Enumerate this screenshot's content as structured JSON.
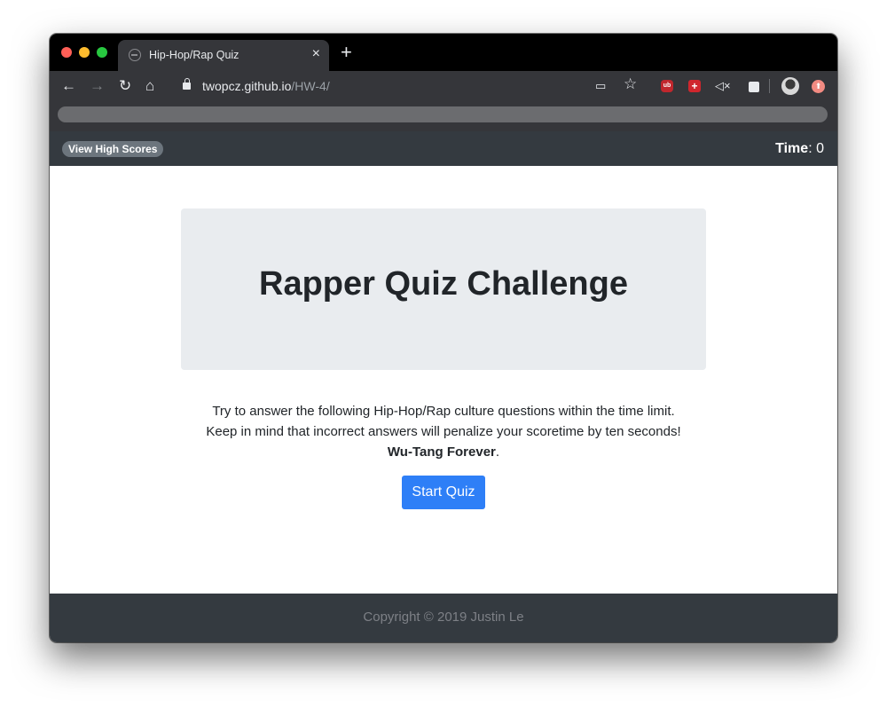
{
  "browser": {
    "tab_title": "Hip-Hop/Rap Quiz",
    "tab_close": "×",
    "new_tab": "+",
    "url_host": "twopcz.github.io",
    "url_path": "/HW-4/",
    "nav": {
      "back": "←",
      "forward": "→",
      "reload": "↻",
      "home": "⌂"
    },
    "toolbar_icons": {
      "cast": "▭",
      "star": "☆",
      "mute": "◁×"
    },
    "extension_ublock": "ub",
    "extension_plus": "+"
  },
  "header": {
    "high_scores_label": "View High Scores",
    "time_label": "Time",
    "time_separator": ":",
    "time_value": "0"
  },
  "main": {
    "title": "Rapper Quiz Challenge",
    "intro_line1": "Try to answer the following Hip-Hop/Rap culture questions within the time limit.",
    "intro_line2": "Keep in mind that incorrect answers will penalize your scoretime by ten seconds!",
    "intro_bold": "Wu-Tang Forever",
    "intro_bold_suffix": ".",
    "start_label": "Start Quiz"
  },
  "footer": {
    "copyright": "Copyright © 2019 Justin Le"
  },
  "colors": {
    "navbar": "#343a40",
    "jumbotron": "#e9ecef",
    "primary": "#2e7ff7",
    "secondary": "#6c757d"
  }
}
